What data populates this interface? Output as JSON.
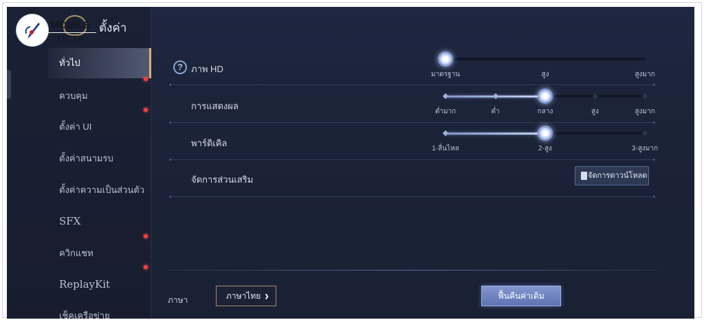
{
  "logo": {
    "line1": "MOBILE",
    "line2": "OCTA"
  },
  "header": {
    "title": "ตั้งค่า"
  },
  "sidebar": {
    "items": [
      {
        "label": "ทั่วไป",
        "active": true,
        "dot": false
      },
      {
        "label": "ควบคุม",
        "active": false,
        "dot": true
      },
      {
        "label": "ตั้งค่า UI",
        "active": false,
        "dot": true
      },
      {
        "label": "ตั้งค่าสนามรบ",
        "active": false,
        "dot": false
      },
      {
        "label": "ตั้งค่าความเป็นส่วนตัว",
        "active": false,
        "dot": false
      },
      {
        "label": "SFX",
        "active": false,
        "dot": false
      },
      {
        "label": "ควิกแชท",
        "active": false,
        "dot": true
      },
      {
        "label": "ReplayKit",
        "active": false,
        "dot": true
      },
      {
        "label": "เช็คเครือข่าย",
        "active": false,
        "dot": false
      }
    ]
  },
  "settings": {
    "hd": {
      "label": "ภาพ HD",
      "help_icon": "?",
      "stops": [
        "มาตรฐาน",
        "สูง",
        "สูงมาก"
      ],
      "selected_index": 0
    },
    "display": {
      "label": "การแสดงผล",
      "stops": [
        "ต่ำมาก",
        "ต่ำ",
        "กลาง",
        "สูง",
        "สูงมาก"
      ],
      "selected_index": 2
    },
    "particle": {
      "label": "พาร์ติเคิล",
      "stops": [
        "1-ลื่นไหล",
        "2-สูง",
        "3-สูงมาก"
      ],
      "selected_index": 1
    },
    "addons": {
      "label": "จัดการส่วนเสริม",
      "button_label": "จัดการดาวน์โหลด",
      "button_icon": "trash-icon"
    }
  },
  "footer": {
    "language_label": "ภาษา",
    "language_value": "ภาษาไทย",
    "reset_label": "ฟื้นคืนค่าเดิม"
  },
  "colors": {
    "accent_gold": "#d7b474",
    "slider_fill": "#c7d4f5",
    "notification_dot": "#ff3b3b",
    "reset_button": "#6f83c2"
  }
}
